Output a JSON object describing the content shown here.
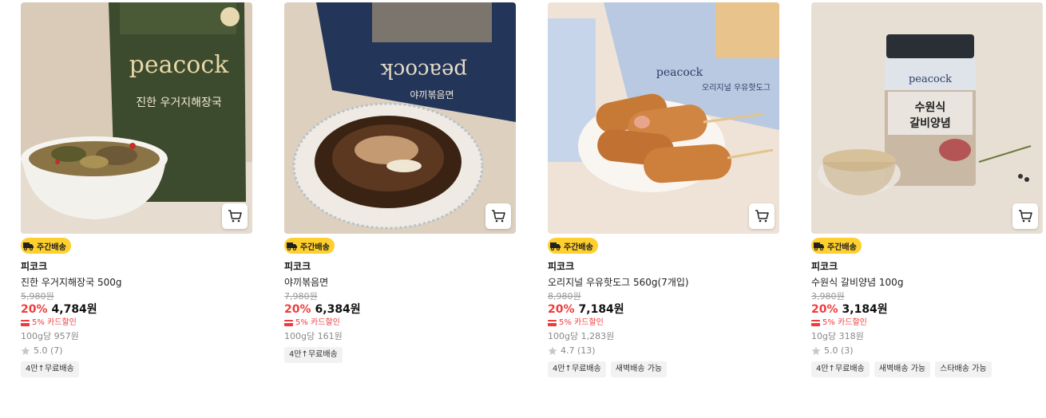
{
  "colors": {
    "discount": "#f03b3b",
    "badge": "#ffcf2e",
    "tag_bg": "#f2f2f2"
  },
  "products": [
    {
      "badge": "주간배송",
      "brand": "피코크",
      "name": "진한 우거지해장국 500g",
      "original_price": "5,980원",
      "discount": "20%",
      "price": "4,784원",
      "card_sale": "5% 카드할인",
      "unit_price": "100g당 957원",
      "rating": "5.0 (7)",
      "tags": [
        "4만↑무료배송"
      ],
      "image_text": {
        "logo": "peacock",
        "title": "진한 우거지해장국"
      }
    },
    {
      "badge": "주간배송",
      "brand": "피코크",
      "name": "야끼볶음면",
      "original_price": "7,980원",
      "discount": "20%",
      "price": "6,384원",
      "card_sale": "5% 카드할인",
      "unit_price": "100g당 161원",
      "rating": "",
      "tags": [
        "4만↑무료배송"
      ],
      "image_text": {
        "logo": "peacock",
        "title": "야끼볶음면"
      }
    },
    {
      "badge": "주간배송",
      "brand": "피코크",
      "name": "오리지널 우유핫도그 560g(7개입)",
      "original_price": "8,980원",
      "discount": "20%",
      "price": "7,184원",
      "card_sale": "5% 카드할인",
      "unit_price": "100g당 1,283원",
      "rating": "4.7 (13)",
      "tags": [
        "4만↑무료배송",
        "새벽배송 가능"
      ],
      "image_text": {
        "logo": "peacock",
        "title": "오리지널 우유핫도그"
      }
    },
    {
      "badge": "주간배송",
      "brand": "피코크",
      "name": "수원식 갈비양념 100g",
      "original_price": "3,980원",
      "discount": "20%",
      "price": "3,184원",
      "card_sale": "5% 카드할인",
      "unit_price": "10g당 318원",
      "rating": "5.0 (3)",
      "tags": [
        "4만↑무료배송",
        "새벽배송 가능",
        "스타배송 가능"
      ],
      "image_text": {
        "logo": "peacock",
        "title1": "수원식",
        "title2": "갈비양념"
      }
    }
  ]
}
